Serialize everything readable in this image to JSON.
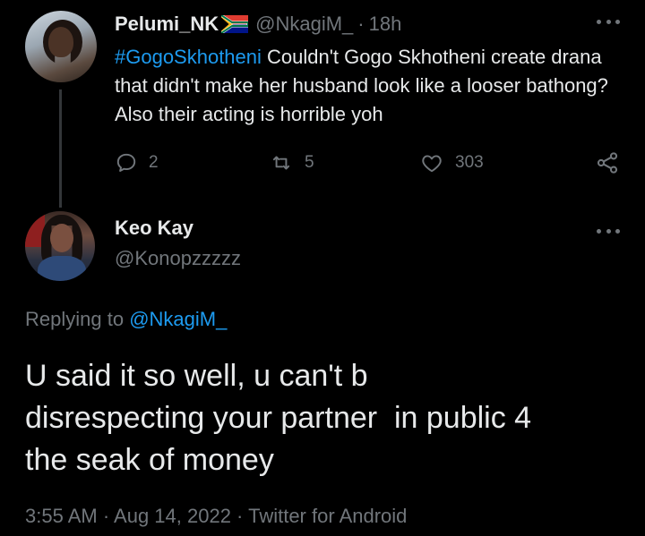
{
  "parent_tweet": {
    "display_name": "Pelumi_NK",
    "handle": "@NkagiM_",
    "separator": "·",
    "time": "18h",
    "hashtag": "#GogoSkhotheni",
    "text": " Couldn't Gogo Skhotheni create drana that didn't make her husband look like a looser bathong? Also their acting is horrible yoh",
    "replies": "2",
    "retweets": "5",
    "likes": "303",
    "icons": {
      "flag": "south-africa-flag-icon",
      "reply": "reply-icon",
      "retweet": "retweet-icon",
      "like": "heart-icon",
      "share": "share-icon",
      "more": "more-icon"
    }
  },
  "main_tweet": {
    "display_name": "Keo Kay",
    "handle": "@Konopzzzzz",
    "replying_prefix": "Replying to ",
    "replying_to": "@NkagiM_",
    "text": "U said it so well, u can't b\ndisrespecting your partner  in public 4\nthe seak of money",
    "timestamp": "3:55 AM · Aug 14, 2022 · Twitter for Android"
  },
  "colors": {
    "background": "#000000",
    "primary_text": "#e7e9ea",
    "secondary_text": "#71767b",
    "accent": "#1d9bf0",
    "thread_line": "#333639"
  }
}
